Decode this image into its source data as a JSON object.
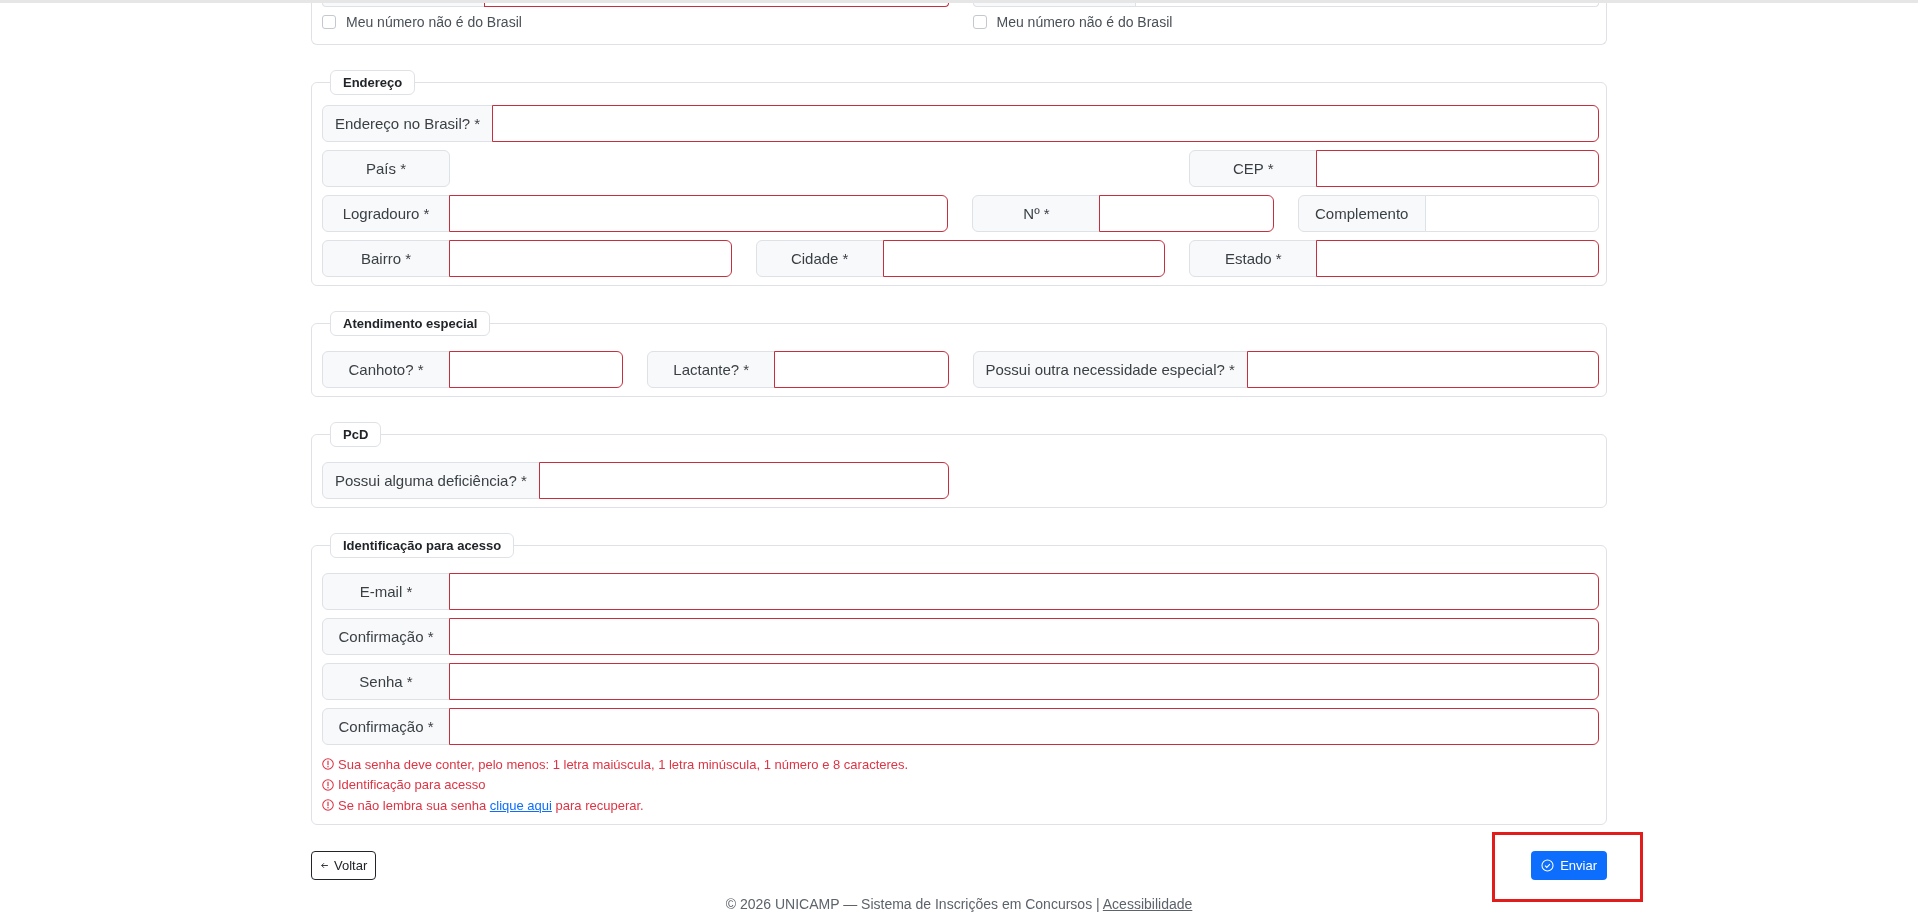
{
  "top_section": {
    "fields": [
      {
        "invalid": true
      },
      {
        "invalid": false
      }
    ],
    "checkboxes": [
      {
        "label": "Meu número não é do Brasil",
        "checked": false
      },
      {
        "label": "Meu número não é do Brasil",
        "checked": false
      }
    ]
  },
  "sections": [
    {
      "legend": "Endereço",
      "rows": [
        {
          "fields": [
            {
              "label": "Endereço no Brasil? *",
              "kind": "input",
              "invalid": true
            }
          ]
        },
        {
          "fields": [
            {
              "label": "País *",
              "kind": "label_only"
            },
            {
              "label": "CEP *",
              "kind": "input",
              "invalid": true
            }
          ]
        },
        {
          "fields": [
            {
              "label": "Logradouro *",
              "kind": "input",
              "invalid": true
            },
            {
              "label": "Nº *",
              "kind": "input",
              "invalid": true
            },
            {
              "label": "Complemento",
              "kind": "input",
              "invalid": false
            }
          ]
        },
        {
          "fields": [
            {
              "label": "Bairro *",
              "kind": "input",
              "invalid": true
            },
            {
              "label": "Cidade *",
              "kind": "input",
              "invalid": true
            },
            {
              "label": "Estado *",
              "kind": "input",
              "invalid": true
            }
          ]
        }
      ]
    },
    {
      "legend": "Atendimento especial",
      "rows": [
        {
          "fields": [
            {
              "label": "Canhoto? *",
              "kind": "input",
              "invalid": true
            },
            {
              "label": "Lactante? *",
              "kind": "input",
              "invalid": true
            },
            {
              "label": "Possui outra necessidade especial? *",
              "kind": "input",
              "invalid": true
            }
          ]
        }
      ]
    },
    {
      "legend": "PcD",
      "rows": [
        {
          "fields": [
            {
              "label": "Possui alguma deficiência? *",
              "kind": "input",
              "invalid": true
            }
          ]
        }
      ]
    },
    {
      "legend": "Identificação para acesso",
      "rows": [
        {
          "fields": [
            {
              "label": "E-mail *",
              "kind": "input",
              "invalid": true
            }
          ]
        },
        {
          "fields": [
            {
              "label": "Confirmação *",
              "kind": "input",
              "invalid": true
            }
          ]
        },
        {
          "fields": [
            {
              "label": "Senha *",
              "kind": "input",
              "invalid": true
            }
          ]
        },
        {
          "fields": [
            {
              "label": "Confirmação *",
              "kind": "input",
              "invalid": true
            }
          ]
        }
      ],
      "errors": [
        {
          "text": "Sua senha deve conter, pelo menos: 1 letra maiúscula, 1 letra minúscula, 1 número e 8 caracteres."
        },
        {
          "text": "Identificação para acesso"
        },
        {
          "text": "Se não lembra sua senha",
          "link": "clique aqui",
          "after": "para recuperar."
        }
      ]
    }
  ],
  "actions": {
    "back": {
      "label": "Voltar"
    },
    "submit": {
      "label": "Enviar",
      "highlighted": true
    }
  },
  "footer": {
    "text": "© 2026 UNICAMP — Sistema de Inscrições em Concursos |",
    "link": "Acessibilidade"
  }
}
